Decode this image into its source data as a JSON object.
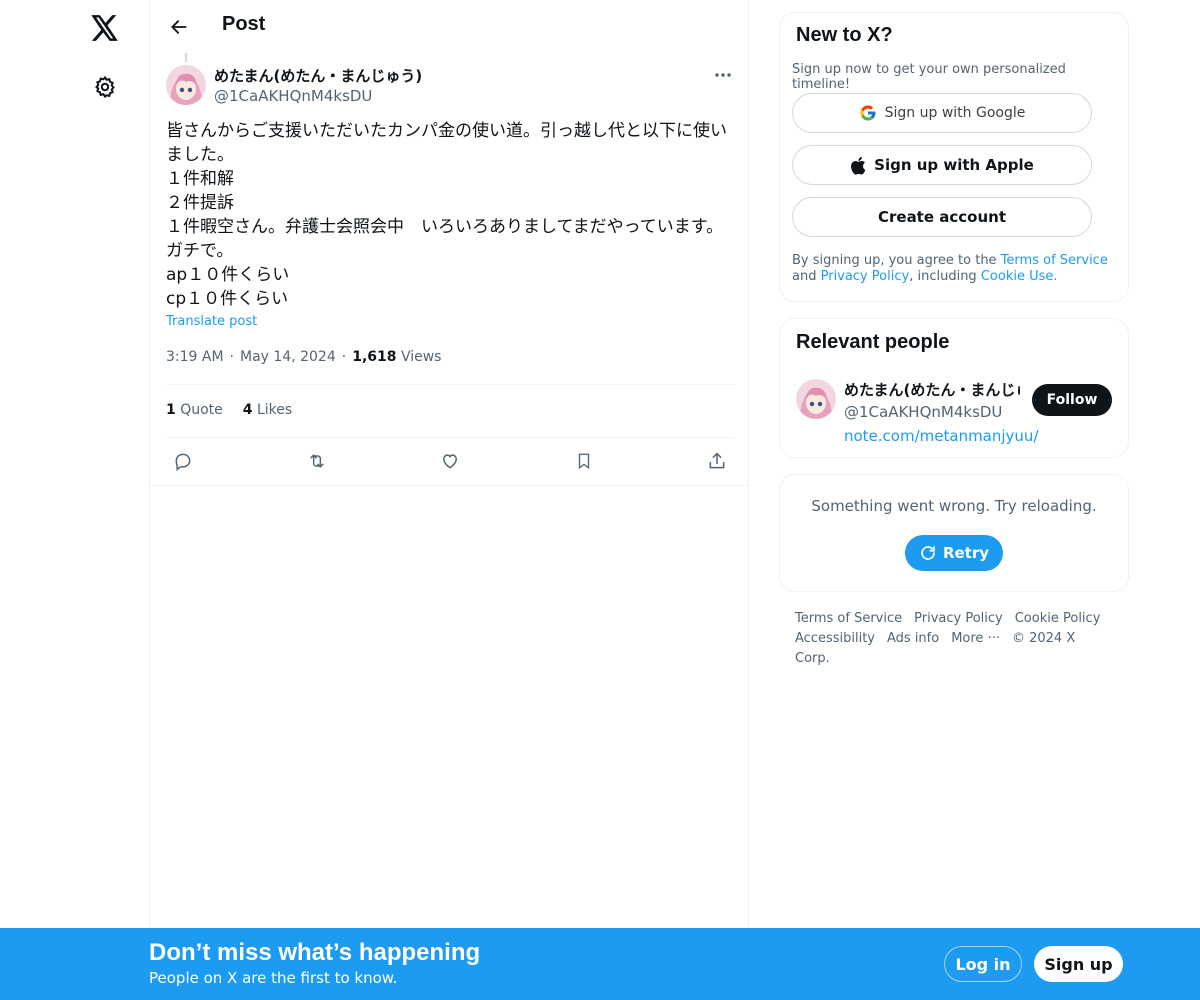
{
  "header": {
    "title": "Post"
  },
  "post": {
    "author_name": "めたまん(めたん・まんじゅう)",
    "author_handle": "@1CaAKHQnM4ksDU",
    "lines": [
      "皆さんからご支援いただいたカンパ金の使い道。引っ越し代と以下に使い",
      "ました。",
      "１件和解",
      "２件提訴",
      "１件暇空さん。弁護士会照会中　いろいろありましてまだやっています。",
      "ガチで。",
      "ap１０件くらい",
      "cp１０件くらい"
    ],
    "translate_label": "Translate post",
    "time": "3:19 AM",
    "date": "May 14, 2024",
    "views_count": "1,618",
    "views_label": "Views",
    "quotes_count": "1",
    "quotes_label": "Quote",
    "likes_count": "4",
    "likes_label": "Likes",
    "separator": "·"
  },
  "signup_card": {
    "title": "New to X?",
    "subtitle": "Sign up now to get your own personalized timeline!",
    "google_label": "Sign up with Google",
    "apple_label": "Sign up with Apple",
    "create_label": "Create account",
    "terms_prefix": "By signing up, you agree to the",
    "terms_link": "Terms of Service",
    "terms_and": "and",
    "privacy_link": "Privacy Policy",
    "terms_including": ", including",
    "cookie_link": "Cookie Use."
  },
  "relevant_people": {
    "title": "Relevant people",
    "name": "めたまん(めたん・まんじゅう)",
    "handle": "@1CaAKHQnM4ksDU",
    "link": "note.com/metanmanjyuu/",
    "follow_label": "Follow"
  },
  "error_card": {
    "message": "Something went wrong. Try reloading.",
    "retry_label": "Retry"
  },
  "footer": {
    "links": [
      "Terms of Service",
      "Privacy Policy",
      "Cookie Policy",
      "Accessibility",
      "Ads info",
      "More ···",
      "© 2024 X Corp."
    ]
  },
  "banner": {
    "title": "Don’t miss what’s happening",
    "subtitle": "People on X are the first to know.",
    "login_label": "Log in",
    "signup_label": "Sign up"
  },
  "colors": {
    "accent": "#1d9bf0",
    "text": "#0f1419",
    "muted": "#536471",
    "border": "#eff3f4"
  },
  "icons": {
    "logo": "x-logo-icon",
    "settings": "gear-icon",
    "back": "arrow-left-icon",
    "more": "more-horizontal-icon",
    "reply": "reply-icon",
    "repost": "repost-icon",
    "like": "heart-icon",
    "bookmark": "bookmark-icon",
    "share": "share-icon",
    "google": "google-icon",
    "apple": "apple-icon",
    "retry": "refresh-icon"
  }
}
